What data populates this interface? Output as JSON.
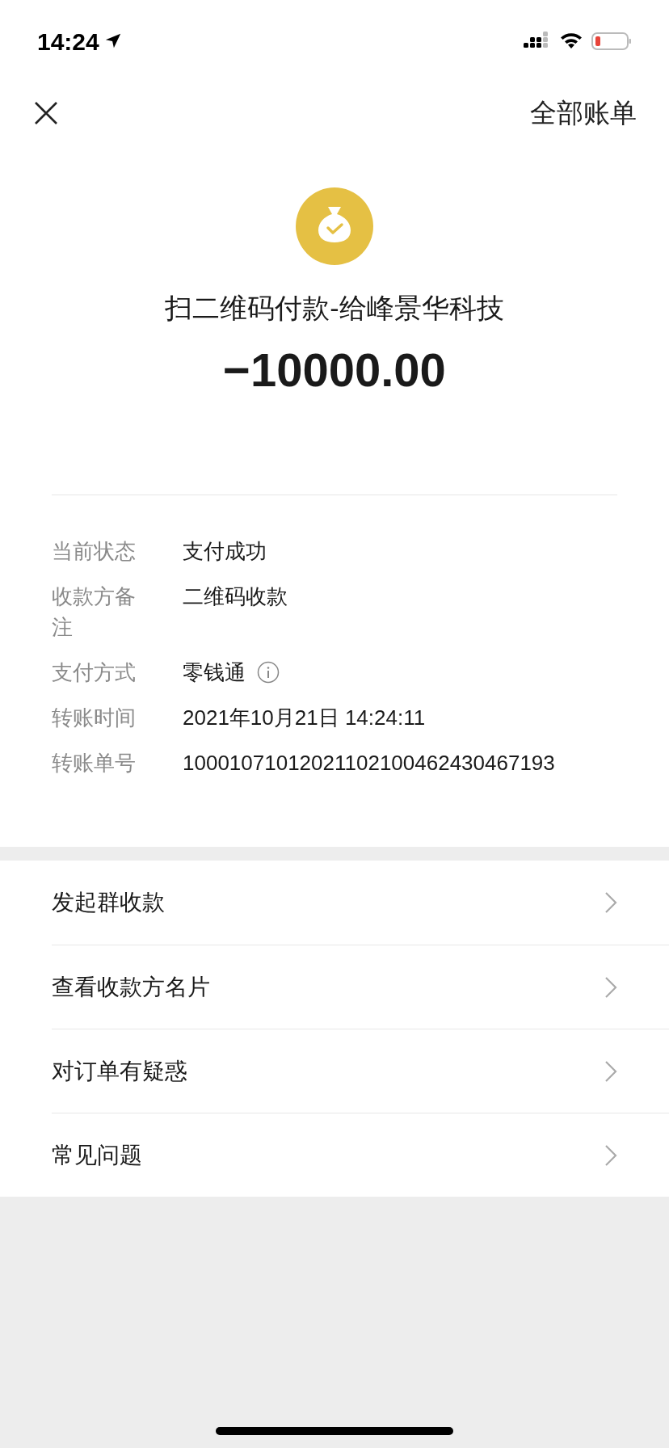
{
  "status_bar": {
    "time": "14:24"
  },
  "nav": {
    "action": "全部账单"
  },
  "payment": {
    "title": "扫二维码付款-给峰景华科技",
    "amount": "−10000.00"
  },
  "details": [
    {
      "label": "当前状态",
      "value": "支付成功",
      "info": false
    },
    {
      "label": "收款方备注",
      "value": "二维码收款",
      "info": false
    },
    {
      "label": "支付方式",
      "value": "零钱通",
      "info": true
    },
    {
      "label": "转账时间",
      "value": "2021年10月21日 14:24:11",
      "info": false
    },
    {
      "label": "转账单号",
      "value": "10001071012021102100462430467193",
      "info": false
    }
  ],
  "menu": [
    "发起群收款",
    "查看收款方名片",
    "对订单有疑惑",
    "常见问题"
  ]
}
